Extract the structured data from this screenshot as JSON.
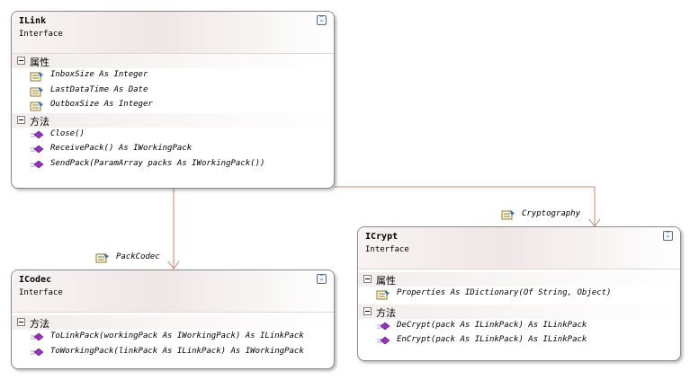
{
  "classes": {
    "ilink": {
      "name": "ILink",
      "kind": "Interface",
      "properties_title": "属性",
      "properties": [
        "InboxSize As Integer",
        "LastDataTime As Date",
        "OutboxSize As Integer"
      ],
      "methods_title": "方法",
      "methods": [
        "Close()",
        "ReceivePack() As IWorkingPack",
        "SendPack(ParamArray packs As IWorkingPack())"
      ]
    },
    "icodec": {
      "name": "ICodec",
      "kind": "Interface",
      "methods_title": "方法",
      "methods": [
        "ToLinkPack(workingPack As IWorkingPack) As ILinkPack",
        "ToWorkingPack(linkPack As ILinkPack) As IWorkingPack"
      ]
    },
    "icrypt": {
      "name": "ICrypt",
      "kind": "Interface",
      "properties_title": "属性",
      "properties": [
        "Properties As IDictionary(Of String, Object)"
      ],
      "methods_title": "方法",
      "methods": [
        "DeCrypt(pack As ILinkPack) As ILinkPack",
        "EnCrypt(pack As ILinkPack) As ILinkPack"
      ]
    }
  },
  "connectors": {
    "packcodec": "PackCodec",
    "cryptography": "Cryptography"
  },
  "colors": {
    "connector": "#c0887a",
    "border": "#8a8a8a",
    "method_icon": "#9b30c0"
  }
}
